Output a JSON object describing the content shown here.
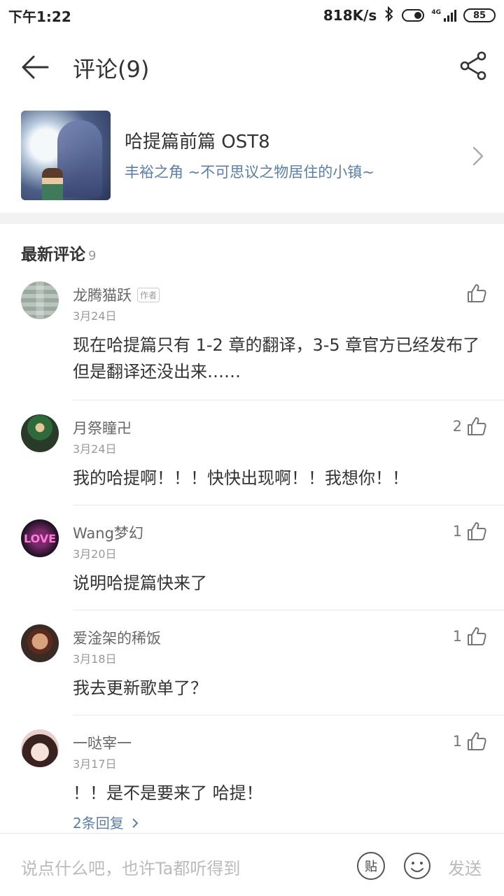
{
  "status_bar": {
    "time": "下午1:22",
    "network_speed": "818K/s",
    "network_type": "4G",
    "battery": "85"
  },
  "header": {
    "title": "评论(9)"
  },
  "song": {
    "title": "哈提篇前篇 OST8",
    "album": "丰裕之角 ~不可思议之物居住的小镇~"
  },
  "section": {
    "title": "最新评论",
    "count": "9"
  },
  "comments": [
    {
      "name": "龙腾猫跃",
      "tag": "作者",
      "date": "3月24日",
      "text": "现在哈提篇只有 1-2 章的翻译，3-5 章官方已经发布了但是翻译还没出来……",
      "likes": ""
    },
    {
      "name": "月祭瞳卍",
      "date": "3月24日",
      "text": "我的哈提啊！！！快快出现啊！！我想你！！",
      "likes": "2"
    },
    {
      "name": "Wang梦幻",
      "date": "3月20日",
      "text": "说明哈提篇快来了",
      "likes": "1"
    },
    {
      "name": "爱淦架的稀饭",
      "date": "3月18日",
      "text": "我去更新歌单了？",
      "likes": "1"
    },
    {
      "name": "一哒宰一",
      "date": "3月17日",
      "text": "！！是不是要来了 哈提！",
      "likes": "1",
      "replies": "2条回复"
    }
  ],
  "input_bar": {
    "placeholder": "说点什么吧，也许Ta都听得到",
    "tie_label": "贴",
    "send_label": "发送"
  },
  "colors": {
    "link": "#5c7ea6",
    "band": "#f2f2f2"
  }
}
